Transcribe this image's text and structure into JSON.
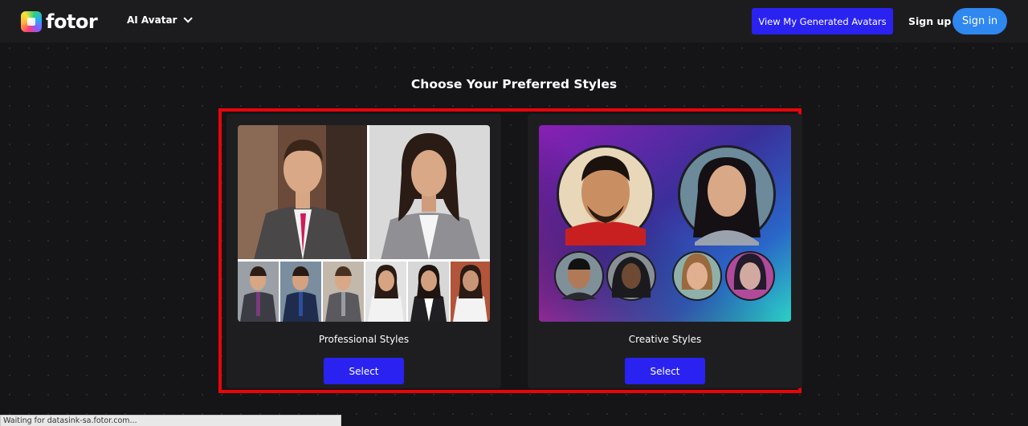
{
  "header": {
    "logo_text": "fotor",
    "nav_label": "AI Avatar",
    "generated_button": "View My Generated Avatars",
    "signup_label": "Sign up",
    "signin_label": "Sign in"
  },
  "main": {
    "title": "Choose Your Preferred Styles",
    "cards": [
      {
        "label": "Professional Styles",
        "button": "Select"
      },
      {
        "label": "Creative Styles",
        "button": "Select"
      }
    ]
  },
  "status_bar": {
    "text": "Waiting for datasink-sa.fotor.com..."
  },
  "colors": {
    "accent_button": "#2a22f0",
    "signin_button": "#2f87f0",
    "highlight_border": "#e8040a",
    "background": "#151517"
  }
}
